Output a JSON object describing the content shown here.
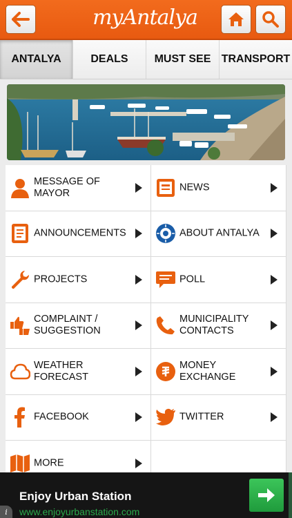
{
  "header": {
    "logo": "myAntalya"
  },
  "tabs": [
    {
      "label": "ANTALYA",
      "active": true
    },
    {
      "label": "DEALS"
    },
    {
      "label": "MUST SEE"
    },
    {
      "label": "TRANSPORT"
    }
  ],
  "menu": [
    {
      "label": "MESSAGE OF MAYOR",
      "icon": "person-icon"
    },
    {
      "label": "NEWS",
      "icon": "newspaper-icon"
    },
    {
      "label": "ANNOUNCEMENTS",
      "icon": "document-icon"
    },
    {
      "label": "ABOUT ANTALYA",
      "icon": "city-seal-icon"
    },
    {
      "label": "PROJECTS",
      "icon": "wrench-icon"
    },
    {
      "label": "POLL",
      "icon": "chat-bubble-icon"
    },
    {
      "label": "COMPLAINT / SUGGESTION",
      "icon": "thumbs-icon"
    },
    {
      "label": "MUNICIPALITY CONTACTS",
      "icon": "phone-icon"
    },
    {
      "label": "WEATHER FORECAST",
      "icon": "cloud-icon"
    },
    {
      "label": "MONEY EXCHANGE",
      "icon": "currency-icon"
    },
    {
      "label": "FACEBOOK",
      "icon": "facebook-icon"
    },
    {
      "label": "TWITTER",
      "icon": "twitter-icon"
    },
    {
      "label": "MORE",
      "icon": "map-icon"
    }
  ],
  "ad": {
    "title": "Enjoy Urban Station",
    "url": "www.enjoyurbanstation.com",
    "info": "i"
  },
  "colors": {
    "accent": "#f26b1d",
    "adButton": "#2aa84a"
  }
}
